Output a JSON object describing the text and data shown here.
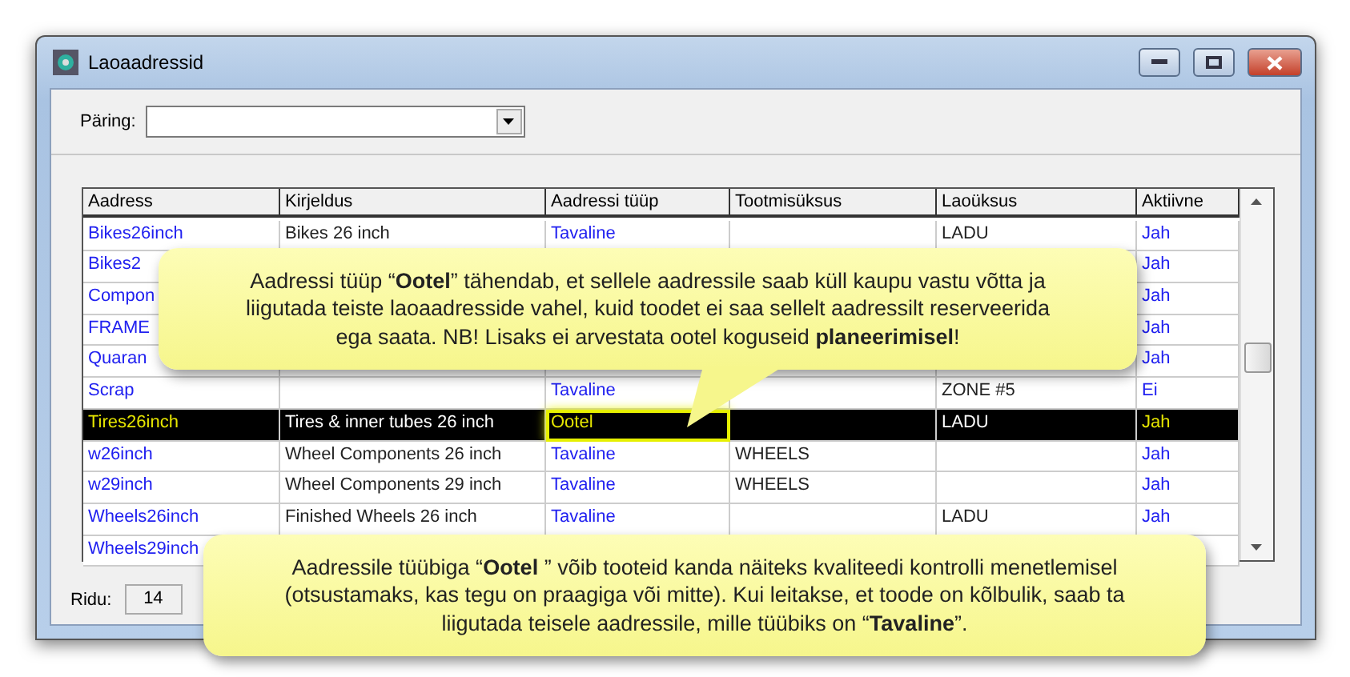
{
  "window": {
    "title": "Laoaadressid"
  },
  "query": {
    "label": "Päring:"
  },
  "table": {
    "columns": [
      "Aadress",
      "Kirjeldus",
      "Aadressi tüüp",
      "Tootmisüksus",
      "Laoüksus",
      "Aktiivne"
    ],
    "rows": [
      {
        "selected": false,
        "type_highlighted": false,
        "cells": [
          "Bikes26inch",
          "Bikes 26 inch",
          "Tavaline",
          "",
          "LADU",
          "Jah"
        ]
      },
      {
        "selected": false,
        "cells": [
          "Bikes2",
          "",
          "",
          "",
          "",
          "Jah"
        ]
      },
      {
        "selected": false,
        "cells": [
          "Compon",
          "",
          "",
          "",
          "",
          "Jah"
        ]
      },
      {
        "selected": false,
        "cells": [
          "FRAME",
          "",
          "",
          "",
          "",
          "Jah"
        ]
      },
      {
        "selected": false,
        "cells": [
          "Quaran",
          "",
          "",
          "",
          "",
          "Jah"
        ]
      },
      {
        "selected": false,
        "type_highlighted": false,
        "cells": [
          "Scrap",
          "",
          "Tavaline",
          "",
          "ZONE #5",
          "Ei"
        ]
      },
      {
        "selected": true,
        "type_highlighted": true,
        "cells": [
          "Tires26inch",
          "Tires & inner tubes 26 inch",
          "Ootel",
          "",
          "LADU",
          "Jah"
        ]
      },
      {
        "selected": false,
        "type_highlighted": false,
        "cells": [
          "w26inch",
          "Wheel Components 26 inch",
          "Tavaline",
          "WHEELS",
          "",
          "Jah"
        ]
      },
      {
        "selected": false,
        "type_highlighted": false,
        "cells": [
          "w29inch",
          "Wheel Components 29 inch",
          "Tavaline",
          "WHEELS",
          "",
          "Jah"
        ]
      },
      {
        "selected": false,
        "type_highlighted": false,
        "cells": [
          "Wheels26inch",
          "Finished Wheels 26 inch",
          "Tavaline",
          "",
          "LADU",
          "Jah"
        ]
      },
      {
        "selected": false,
        "cells": [
          "Wheels29inch",
          "",
          "",
          "",
          "",
          ""
        ]
      }
    ]
  },
  "status_bar": {
    "label": "Ridu:",
    "count": "14"
  },
  "callouts": [
    {
      "text": "Aadressi tüüp “**Ootel**” tähendab, et sellele aadressile saab küll kaupu vastu võtta ja liigutada teiste laoaadresside vahel, kuid toodet ei saa sellelt aadressilt reserveerida ega saata. NB! Lisaks ei arvestata ootel koguseid **planeerimisel**!",
      "pointer": true
    },
    {
      "text": "Aadressile tüübiga “**Ootel** ” võib tooteid kanda näiteks kvaliteedi kontrolli menetlemisel (otsustamaks, kas tegu on praagiga või mitte). Kui leitakse, et toode on kõlbulik, saab ta liigutada teisele aadressile, mille tüübiks on “**Tavaline**”.",
      "pointer": false
    }
  ]
}
